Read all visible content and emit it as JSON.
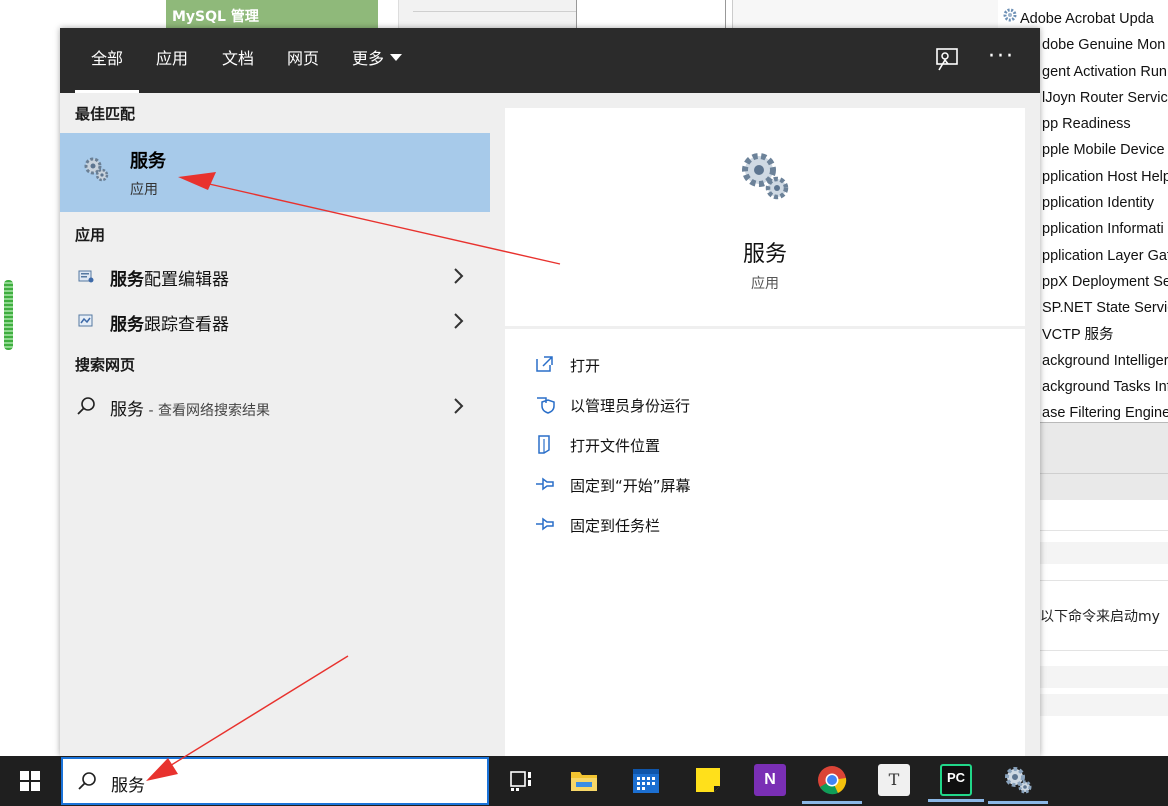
{
  "background": {
    "mysql_tab": "MySQL 管理",
    "services_rows": [
      "Adobe Acrobat Upda",
      "dobe Genuine Mon",
      "gent Activation Run",
      "lJoyn Router Servic",
      "pp Readiness",
      "pple Mobile Device",
      "pplication Host Help",
      "pplication Identity",
      "pplication Informati",
      "pplication Layer Gat",
      "ppX Deployment Se",
      "SP.NET State Servic",
      "VCTP 服务",
      "ackground Intelliger",
      "ackground Tasks Inf",
      "ase Filtering Engine"
    ],
    "command_snippet": "以下命令来启动my"
  },
  "tabs": [
    {
      "label": "全部",
      "active": true
    },
    {
      "label": "应用"
    },
    {
      "label": "文档"
    },
    {
      "label": "网页"
    },
    {
      "label": "更多"
    }
  ],
  "left": {
    "best_match_header": "最佳匹配",
    "best_match": {
      "title": "服务",
      "subtitle": "应用"
    },
    "apps_header": "应用",
    "apps": [
      {
        "bold": "服务",
        "rest": "配置编辑器"
      },
      {
        "bold": "服务",
        "rest": "跟踪查看器"
      }
    ],
    "web_header": "搜索网页",
    "web_item": {
      "query": "服务",
      "hint": " - 查看网络搜索结果"
    }
  },
  "right": {
    "title": "服务",
    "subtitle": "应用",
    "actions": [
      {
        "label": "打开",
        "icon": "open-window-icon"
      },
      {
        "label": "以管理员身份运行",
        "icon": "shield-icon"
      },
      {
        "label": "打开文件位置",
        "icon": "file-location-icon"
      },
      {
        "label": "固定到“开始”屏幕",
        "icon": "pin-icon"
      },
      {
        "label": "固定到任务栏",
        "icon": "pin-icon"
      }
    ]
  },
  "taskbar": {
    "search_text": "服务",
    "apps": [
      "task-view-icon",
      "file-explorer-icon",
      "calendar-icon",
      "sticky-notes-icon",
      "onenote-icon",
      "chrome-icon",
      "typora-icon",
      "pycharm-icon",
      "services-icon"
    ],
    "onenote_glyph": "N",
    "typora_glyph": "T",
    "pycharm_glyph": "PC"
  },
  "colors": {
    "accent_selected": "#a7caea",
    "topbar": "#2b2b2b",
    "search_border": "#1a73d9",
    "annotation_arrow": "#e8322e"
  }
}
